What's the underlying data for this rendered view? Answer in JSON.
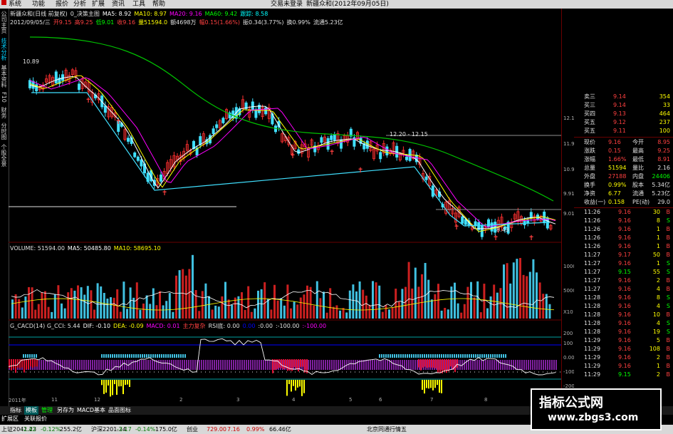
{
  "menu": {
    "items": [
      "系统",
      "功能",
      "报价",
      "分析",
      "扩展",
      "资讯",
      "工具",
      "帮助"
    ],
    "login_status": "交易未登录",
    "title_right": "新疆众和(2012年09月05日)"
  },
  "sidebar": {
    "items": [
      "公司主页",
      "技术分析",
      "基本资料",
      "F10",
      "财务",
      "分时图",
      "个股全景"
    ]
  },
  "chart_header": {
    "line1": [
      {
        "text": "新疆众和(日线 前复权)",
        "color": "#e0e0e0"
      },
      {
        "text": "0_决策主图",
        "color": "#e0e0e0"
      },
      {
        "text": "MA5: 8.92",
        "color": "#ffffff"
      },
      {
        "text": "MA10: 8.97",
        "color": "#ffff00"
      },
      {
        "text": "MA20: 9.16",
        "color": "#ff00ff"
      },
      {
        "text": "MA60: 9.42",
        "color": "#00ff00"
      },
      {
        "text": "跟踪: 8.58",
        "color": "#00ffff"
      }
    ],
    "line2": [
      {
        "text": "2012/09/05/三",
        "color": "#e0e0e0"
      },
      {
        "text": "开9.15",
        "color": "#ff4040"
      },
      {
        "text": "高9.25",
        "color": "#ff4040"
      },
      {
        "text": "低9.01",
        "color": "#00ff00"
      },
      {
        "text": "收9.16",
        "color": "#ff4040"
      },
      {
        "text": "量51594.0",
        "color": "#ffff00"
      },
      {
        "text": "额4698万",
        "color": "#e0e0e0"
      },
      {
        "text": "幅0.15(1.66%)",
        "color": "#ff4040"
      },
      {
        "text": "振0.34(3.77%)",
        "color": "#e0e0e0"
      },
      {
        "text": "换0.99%",
        "color": "#e0e0e0"
      },
      {
        "text": "流通5.23亿",
        "color": "#e0e0e0"
      }
    ],
    "price_label_high": "10.89",
    "price_label_mid": "12.20 - 12.15",
    "price_label_low": "8.43"
  },
  "price_axis": [
    "12.15",
    "11.93",
    "10.92",
    "9.91",
    "9.01"
  ],
  "volume_header": [
    {
      "text": "VOLUME: 51594.00",
      "color": "#e0e0e0"
    },
    {
      "text": "MA5: 50485.80",
      "color": "#ffffff"
    },
    {
      "text": "MA10: 58695.10",
      "color": "#ffff00"
    }
  ],
  "volume_axis": [
    "10000",
    "5000",
    "X10"
  ],
  "indicator_header": [
    {
      "text": "G_CACD(14) G_CCI: 5.44",
      "color": "#e0e0e0"
    },
    {
      "text": "DIF: -0.10",
      "color": "#ffffff"
    },
    {
      "text": "DEA: -0.09",
      "color": "#ffff00"
    },
    {
      "text": "MACD: 0.01",
      "color": "#ff00ff"
    },
    {
      "text": "主力复杂",
      "color": "#ff4040"
    },
    {
      "text": "RSI底: 0.00",
      "color": "#e0e0e0"
    },
    {
      "text": "0.00",
      "color": "#0000ff"
    },
    {
      "text": ":0.00",
      "color": "#e0e0e0"
    },
    {
      "text": ":-100.00",
      "color": "#e0e0e0"
    },
    {
      "text": ":-100.00",
      "color": "#ff00ff"
    }
  ],
  "indicator_axis": [
    "200",
    "100",
    "0.00",
    "-100",
    "-200"
  ],
  "time_axis": [
    "2011年",
    "11",
    "12",
    "2",
    "3",
    "4",
    "5",
    "6",
    "7",
    "8"
  ],
  "quote_panel": {
    "asks": [
      {
        "label": "卖三",
        "price": "9.14",
        "vol": "354"
      },
      {
        "label": "买三",
        "price": "9.14",
        "vol": "33"
      },
      {
        "label": "买四",
        "price": "9.13",
        "vol": "464"
      },
      {
        "label": "买五",
        "price": "9.12",
        "vol": "237"
      },
      {
        "label": "买五",
        "price": "9.11",
        "vol": "100"
      }
    ],
    "stats": [
      {
        "l1": "现价",
        "v1": "9.16",
        "l2": "今开",
        "v2": "8.95"
      },
      {
        "l1": "涨跌",
        "v1": "0.15",
        "l2": "最高",
        "v2": "9.25"
      },
      {
        "l1": "涨幅",
        "v1": "1.66%",
        "l2": "最低",
        "v2": "8.91"
      },
      {
        "l1": "总量",
        "v1": "51594",
        "l2": "量比",
        "v2": "2.16"
      },
      {
        "l1": "外盘",
        "v1": "27188",
        "l2": "内盘",
        "v2": "24406"
      },
      {
        "l1": "换手",
        "v1": "0.99%",
        "l2": "股本",
        "v2": "5.34亿"
      },
      {
        "l1": "净资",
        "v1": "6.77",
        "l2": "流通",
        "v2": "5.23亿"
      },
      {
        "l1": "收益(一)",
        "v1": "0.158",
        "l2": "PE(动)",
        "v2": "29.0"
      }
    ],
    "ticks": [
      {
        "t": "11:26",
        "p": "9.16",
        "v": "30",
        "s": "B"
      },
      {
        "t": "11:26",
        "p": "9.16",
        "v": "8",
        "s": "S"
      },
      {
        "t": "11:26",
        "p": "9.16",
        "v": "1",
        "s": "B"
      },
      {
        "t": "11:26",
        "p": "9.16",
        "v": "1",
        "s": "B"
      },
      {
        "t": "11:26",
        "p": "9.16",
        "v": "1",
        "s": "B"
      },
      {
        "t": "11:27",
        "p": "9.17",
        "v": "50",
        "s": "B"
      },
      {
        "t": "11:27",
        "p": "9.16",
        "v": "1",
        "s": "S"
      },
      {
        "t": "11:27",
        "p": "9.15",
        "v": "55",
        "s": "S"
      },
      {
        "t": "11:27",
        "p": "9.16",
        "v": "2",
        "s": "B"
      },
      {
        "t": "11:27",
        "p": "9.16",
        "v": "4",
        "s": "B"
      },
      {
        "t": "11:28",
        "p": "9.16",
        "v": "8",
        "s": "S"
      },
      {
        "t": "11:28",
        "p": "9.16",
        "v": "4",
        "s": "S"
      },
      {
        "t": "11:28",
        "p": "9.16",
        "v": "10",
        "s": "B"
      },
      {
        "t": "11:28",
        "p": "9.16",
        "v": "4",
        "s": "S"
      },
      {
        "t": "11:28",
        "p": "9.16",
        "v": "19",
        "s": "S"
      },
      {
        "t": "11:29",
        "p": "9.16",
        "v": "5",
        "s": "B"
      },
      {
        "t": "11:29",
        "p": "9.16",
        "v": "108",
        "s": "B"
      },
      {
        "t": "11:29",
        "p": "9.16",
        "v": "2",
        "s": "B"
      },
      {
        "t": "11:29",
        "p": "9.16",
        "v": "1",
        "s": "B"
      },
      {
        "t": "11:29",
        "p": "9.15",
        "v": "2",
        "s": "B"
      }
    ]
  },
  "bottom_tabs": [
    "指标",
    "模板",
    "管理",
    "另存为",
    "MACD基本",
    "品面图标"
  ],
  "tab_row2": [
    "扩展区",
    "关联报价"
  ],
  "status_bar": [
    {
      "text": "上证2041.23",
      "color": "#000000"
    },
    {
      "text": "-2.42",
      "color": "#007700"
    },
    {
      "text": "-0.12%",
      "color": "#007700"
    },
    {
      "text": "255.2亿",
      "color": "#000000"
    },
    {
      "text": "沪深2201.24",
      "color": "#000000"
    },
    {
      "text": "-3.17",
      "color": "#007700"
    },
    {
      "text": "-0.14%",
      "color": "#007700"
    },
    {
      "text": "175.0亿",
      "color": "#000000"
    },
    {
      "text": "创业",
      "color": "#000000"
    },
    {
      "text": "729.00",
      "color": "#cc0000"
    },
    {
      "text": "7.16",
      "color": "#cc0000"
    },
    {
      "text": "0.99%",
      "color": "#cc0000"
    },
    {
      "text": "66.46亿",
      "color": "#000000"
    },
    {
      "text": "北京同通行情五",
      "color": "#000000"
    }
  ],
  "watermark": {
    "line1": "指标公式网",
    "line2": "www.zbgs3.com"
  }
}
